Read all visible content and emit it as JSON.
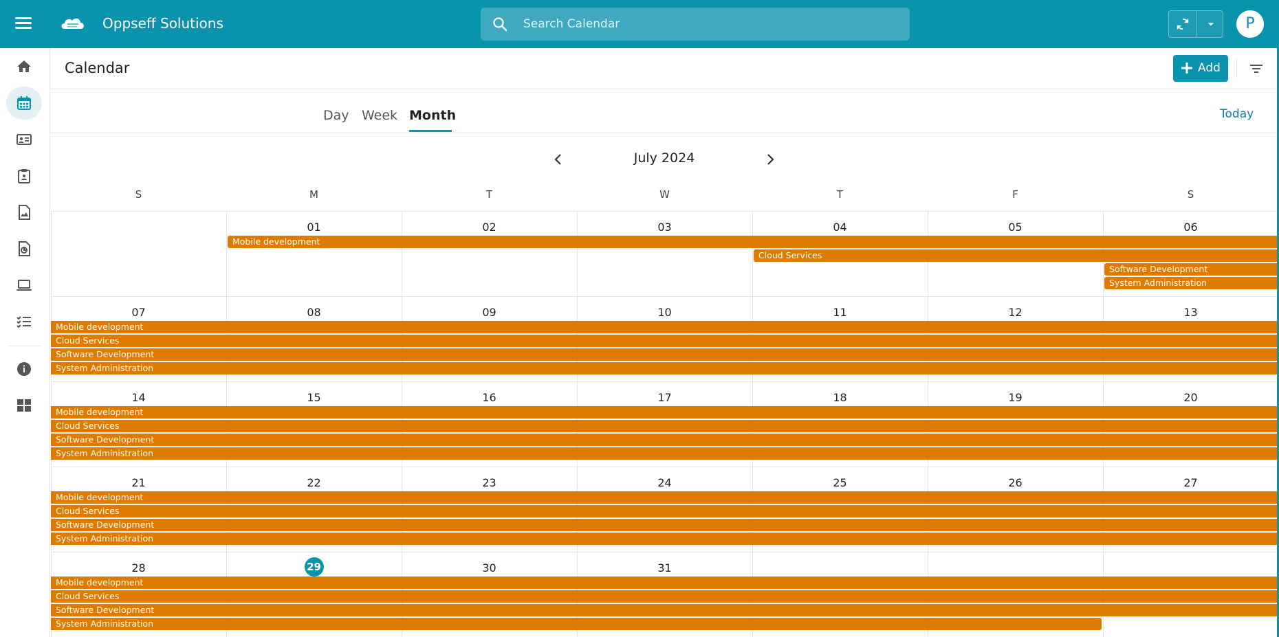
{
  "app": {
    "name": "Oppseff Solutions"
  },
  "search": {
    "placeholder": "Search Calendar"
  },
  "user": {
    "initial": "P"
  },
  "page": {
    "title": "Calendar",
    "add_label": "Add"
  },
  "views": {
    "day": "Day",
    "week": "Week",
    "month": "Month",
    "active": "Month",
    "today_label": "Today"
  },
  "calendar": {
    "month_label": "July 2024",
    "weekdays": [
      "S",
      "M",
      "T",
      "W",
      "T",
      "F",
      "S"
    ],
    "today_date": "29",
    "weeks": [
      [
        "",
        "01",
        "02",
        "03",
        "04",
        "05",
        "06"
      ],
      [
        "07",
        "08",
        "09",
        "10",
        "11",
        "12",
        "13"
      ],
      [
        "14",
        "15",
        "16",
        "17",
        "18",
        "19",
        "20"
      ],
      [
        "21",
        "22",
        "23",
        "24",
        "25",
        "26",
        "27"
      ],
      [
        "28",
        "29",
        "30",
        "31",
        "",
        "",
        ""
      ]
    ],
    "events": [
      {
        "week": 0,
        "lane": 0,
        "start": 1,
        "end": 6,
        "title": "Mobile development",
        "cont_left": false,
        "cont_right": true
      },
      {
        "week": 0,
        "lane": 1,
        "start": 4,
        "end": 6,
        "title": "Cloud Services",
        "cont_left": false,
        "cont_right": true
      },
      {
        "week": 0,
        "lane": 2,
        "start": 6,
        "end": 6,
        "title": "Software Development",
        "cont_left": false,
        "cont_right": true
      },
      {
        "week": 0,
        "lane": 3,
        "start": 6,
        "end": 6,
        "title": "System Administration",
        "cont_left": false,
        "cont_right": true
      },
      {
        "week": 1,
        "lane": 0,
        "start": 0,
        "end": 6,
        "title": "Mobile development",
        "cont_left": true,
        "cont_right": true
      },
      {
        "week": 1,
        "lane": 1,
        "start": 0,
        "end": 6,
        "title": "Cloud Services",
        "cont_left": true,
        "cont_right": true
      },
      {
        "week": 1,
        "lane": 2,
        "start": 0,
        "end": 6,
        "title": "Software Development",
        "cont_left": true,
        "cont_right": true
      },
      {
        "week": 1,
        "lane": 3,
        "start": 0,
        "end": 6,
        "title": "System Administration",
        "cont_left": true,
        "cont_right": true
      },
      {
        "week": 2,
        "lane": 0,
        "start": 0,
        "end": 6,
        "title": "Mobile development",
        "cont_left": true,
        "cont_right": true
      },
      {
        "week": 2,
        "lane": 1,
        "start": 0,
        "end": 6,
        "title": "Cloud Services",
        "cont_left": true,
        "cont_right": true
      },
      {
        "week": 2,
        "lane": 2,
        "start": 0,
        "end": 6,
        "title": "Software Development",
        "cont_left": true,
        "cont_right": true
      },
      {
        "week": 2,
        "lane": 3,
        "start": 0,
        "end": 6,
        "title": "System Administration",
        "cont_left": true,
        "cont_right": true
      },
      {
        "week": 3,
        "lane": 0,
        "start": 0,
        "end": 6,
        "title": "Mobile development",
        "cont_left": true,
        "cont_right": true
      },
      {
        "week": 3,
        "lane": 1,
        "start": 0,
        "end": 6,
        "title": "Cloud Services",
        "cont_left": true,
        "cont_right": true
      },
      {
        "week": 3,
        "lane": 2,
        "start": 0,
        "end": 6,
        "title": "Software Development",
        "cont_left": true,
        "cont_right": true
      },
      {
        "week": 3,
        "lane": 3,
        "start": 0,
        "end": 6,
        "title": "System Administration",
        "cont_left": true,
        "cont_right": true
      },
      {
        "week": 4,
        "lane": 0,
        "start": 0,
        "end": 6,
        "title": "Mobile development",
        "cont_left": true,
        "cont_right": true
      },
      {
        "week": 4,
        "lane": 1,
        "start": 0,
        "end": 6,
        "title": "Cloud Services",
        "cont_left": true,
        "cont_right": true
      },
      {
        "week": 4,
        "lane": 2,
        "start": 0,
        "end": 6,
        "title": "Software Development",
        "cont_left": true,
        "cont_right": true
      },
      {
        "week": 4,
        "lane": 3,
        "start": 0,
        "end": 5,
        "title": "System Administration",
        "cont_left": true,
        "cont_right": false
      }
    ]
  },
  "sidebar": {
    "items": [
      {
        "icon": "home-icon"
      },
      {
        "icon": "calendar-icon",
        "active": true
      },
      {
        "icon": "contact-card-icon"
      },
      {
        "icon": "clipboard-icon"
      },
      {
        "icon": "image-document-icon"
      },
      {
        "icon": "report-chart-icon"
      },
      {
        "icon": "laptop-icon"
      },
      {
        "icon": "checklist-icon"
      },
      {
        "icon": "info-icon"
      },
      {
        "icon": "dashboard-icon"
      }
    ]
  },
  "colors": {
    "primary": "#0a93ad",
    "event": "#dd7a00",
    "sidebar_active_bg": "#e3f1f5"
  }
}
